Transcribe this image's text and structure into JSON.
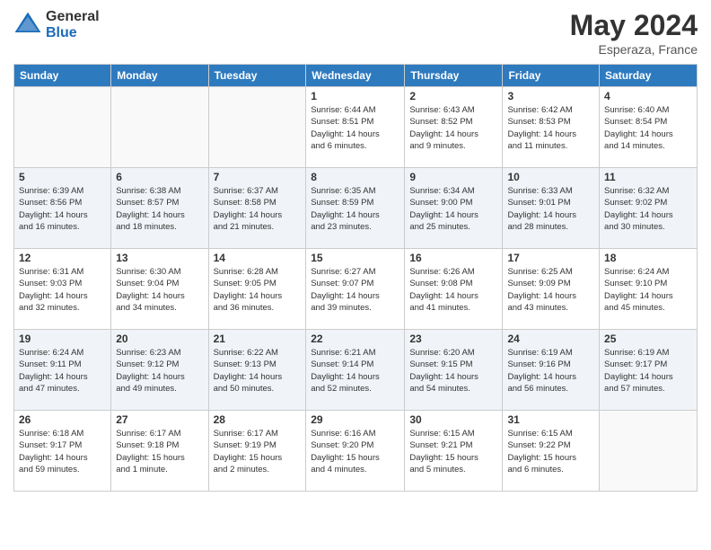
{
  "header": {
    "logo_general": "General",
    "logo_blue": "Blue",
    "month_year": "May 2024",
    "location": "Esperaza, France"
  },
  "weekdays": [
    "Sunday",
    "Monday",
    "Tuesday",
    "Wednesday",
    "Thursday",
    "Friday",
    "Saturday"
  ],
  "weeks": [
    [
      {
        "day": "",
        "info": ""
      },
      {
        "day": "",
        "info": ""
      },
      {
        "day": "",
        "info": ""
      },
      {
        "day": "1",
        "info": "Sunrise: 6:44 AM\nSunset: 8:51 PM\nDaylight: 14 hours\nand 6 minutes."
      },
      {
        "day": "2",
        "info": "Sunrise: 6:43 AM\nSunset: 8:52 PM\nDaylight: 14 hours\nand 9 minutes."
      },
      {
        "day": "3",
        "info": "Sunrise: 6:42 AM\nSunset: 8:53 PM\nDaylight: 14 hours\nand 11 minutes."
      },
      {
        "day": "4",
        "info": "Sunrise: 6:40 AM\nSunset: 8:54 PM\nDaylight: 14 hours\nand 14 minutes."
      }
    ],
    [
      {
        "day": "5",
        "info": "Sunrise: 6:39 AM\nSunset: 8:56 PM\nDaylight: 14 hours\nand 16 minutes."
      },
      {
        "day": "6",
        "info": "Sunrise: 6:38 AM\nSunset: 8:57 PM\nDaylight: 14 hours\nand 18 minutes."
      },
      {
        "day": "7",
        "info": "Sunrise: 6:37 AM\nSunset: 8:58 PM\nDaylight: 14 hours\nand 21 minutes."
      },
      {
        "day": "8",
        "info": "Sunrise: 6:35 AM\nSunset: 8:59 PM\nDaylight: 14 hours\nand 23 minutes."
      },
      {
        "day": "9",
        "info": "Sunrise: 6:34 AM\nSunset: 9:00 PM\nDaylight: 14 hours\nand 25 minutes."
      },
      {
        "day": "10",
        "info": "Sunrise: 6:33 AM\nSunset: 9:01 PM\nDaylight: 14 hours\nand 28 minutes."
      },
      {
        "day": "11",
        "info": "Sunrise: 6:32 AM\nSunset: 9:02 PM\nDaylight: 14 hours\nand 30 minutes."
      }
    ],
    [
      {
        "day": "12",
        "info": "Sunrise: 6:31 AM\nSunset: 9:03 PM\nDaylight: 14 hours\nand 32 minutes."
      },
      {
        "day": "13",
        "info": "Sunrise: 6:30 AM\nSunset: 9:04 PM\nDaylight: 14 hours\nand 34 minutes."
      },
      {
        "day": "14",
        "info": "Sunrise: 6:28 AM\nSunset: 9:05 PM\nDaylight: 14 hours\nand 36 minutes."
      },
      {
        "day": "15",
        "info": "Sunrise: 6:27 AM\nSunset: 9:07 PM\nDaylight: 14 hours\nand 39 minutes."
      },
      {
        "day": "16",
        "info": "Sunrise: 6:26 AM\nSunset: 9:08 PM\nDaylight: 14 hours\nand 41 minutes."
      },
      {
        "day": "17",
        "info": "Sunrise: 6:25 AM\nSunset: 9:09 PM\nDaylight: 14 hours\nand 43 minutes."
      },
      {
        "day": "18",
        "info": "Sunrise: 6:24 AM\nSunset: 9:10 PM\nDaylight: 14 hours\nand 45 minutes."
      }
    ],
    [
      {
        "day": "19",
        "info": "Sunrise: 6:24 AM\nSunset: 9:11 PM\nDaylight: 14 hours\nand 47 minutes."
      },
      {
        "day": "20",
        "info": "Sunrise: 6:23 AM\nSunset: 9:12 PM\nDaylight: 14 hours\nand 49 minutes."
      },
      {
        "day": "21",
        "info": "Sunrise: 6:22 AM\nSunset: 9:13 PM\nDaylight: 14 hours\nand 50 minutes."
      },
      {
        "day": "22",
        "info": "Sunrise: 6:21 AM\nSunset: 9:14 PM\nDaylight: 14 hours\nand 52 minutes."
      },
      {
        "day": "23",
        "info": "Sunrise: 6:20 AM\nSunset: 9:15 PM\nDaylight: 14 hours\nand 54 minutes."
      },
      {
        "day": "24",
        "info": "Sunrise: 6:19 AM\nSunset: 9:16 PM\nDaylight: 14 hours\nand 56 minutes."
      },
      {
        "day": "25",
        "info": "Sunrise: 6:19 AM\nSunset: 9:17 PM\nDaylight: 14 hours\nand 57 minutes."
      }
    ],
    [
      {
        "day": "26",
        "info": "Sunrise: 6:18 AM\nSunset: 9:17 PM\nDaylight: 14 hours\nand 59 minutes."
      },
      {
        "day": "27",
        "info": "Sunrise: 6:17 AM\nSunset: 9:18 PM\nDaylight: 15 hours\nand 1 minute."
      },
      {
        "day": "28",
        "info": "Sunrise: 6:17 AM\nSunset: 9:19 PM\nDaylight: 15 hours\nand 2 minutes."
      },
      {
        "day": "29",
        "info": "Sunrise: 6:16 AM\nSunset: 9:20 PM\nDaylight: 15 hours\nand 4 minutes."
      },
      {
        "day": "30",
        "info": "Sunrise: 6:15 AM\nSunset: 9:21 PM\nDaylight: 15 hours\nand 5 minutes."
      },
      {
        "day": "31",
        "info": "Sunrise: 6:15 AM\nSunset: 9:22 PM\nDaylight: 15 hours\nand 6 minutes."
      },
      {
        "day": "",
        "info": ""
      }
    ]
  ]
}
